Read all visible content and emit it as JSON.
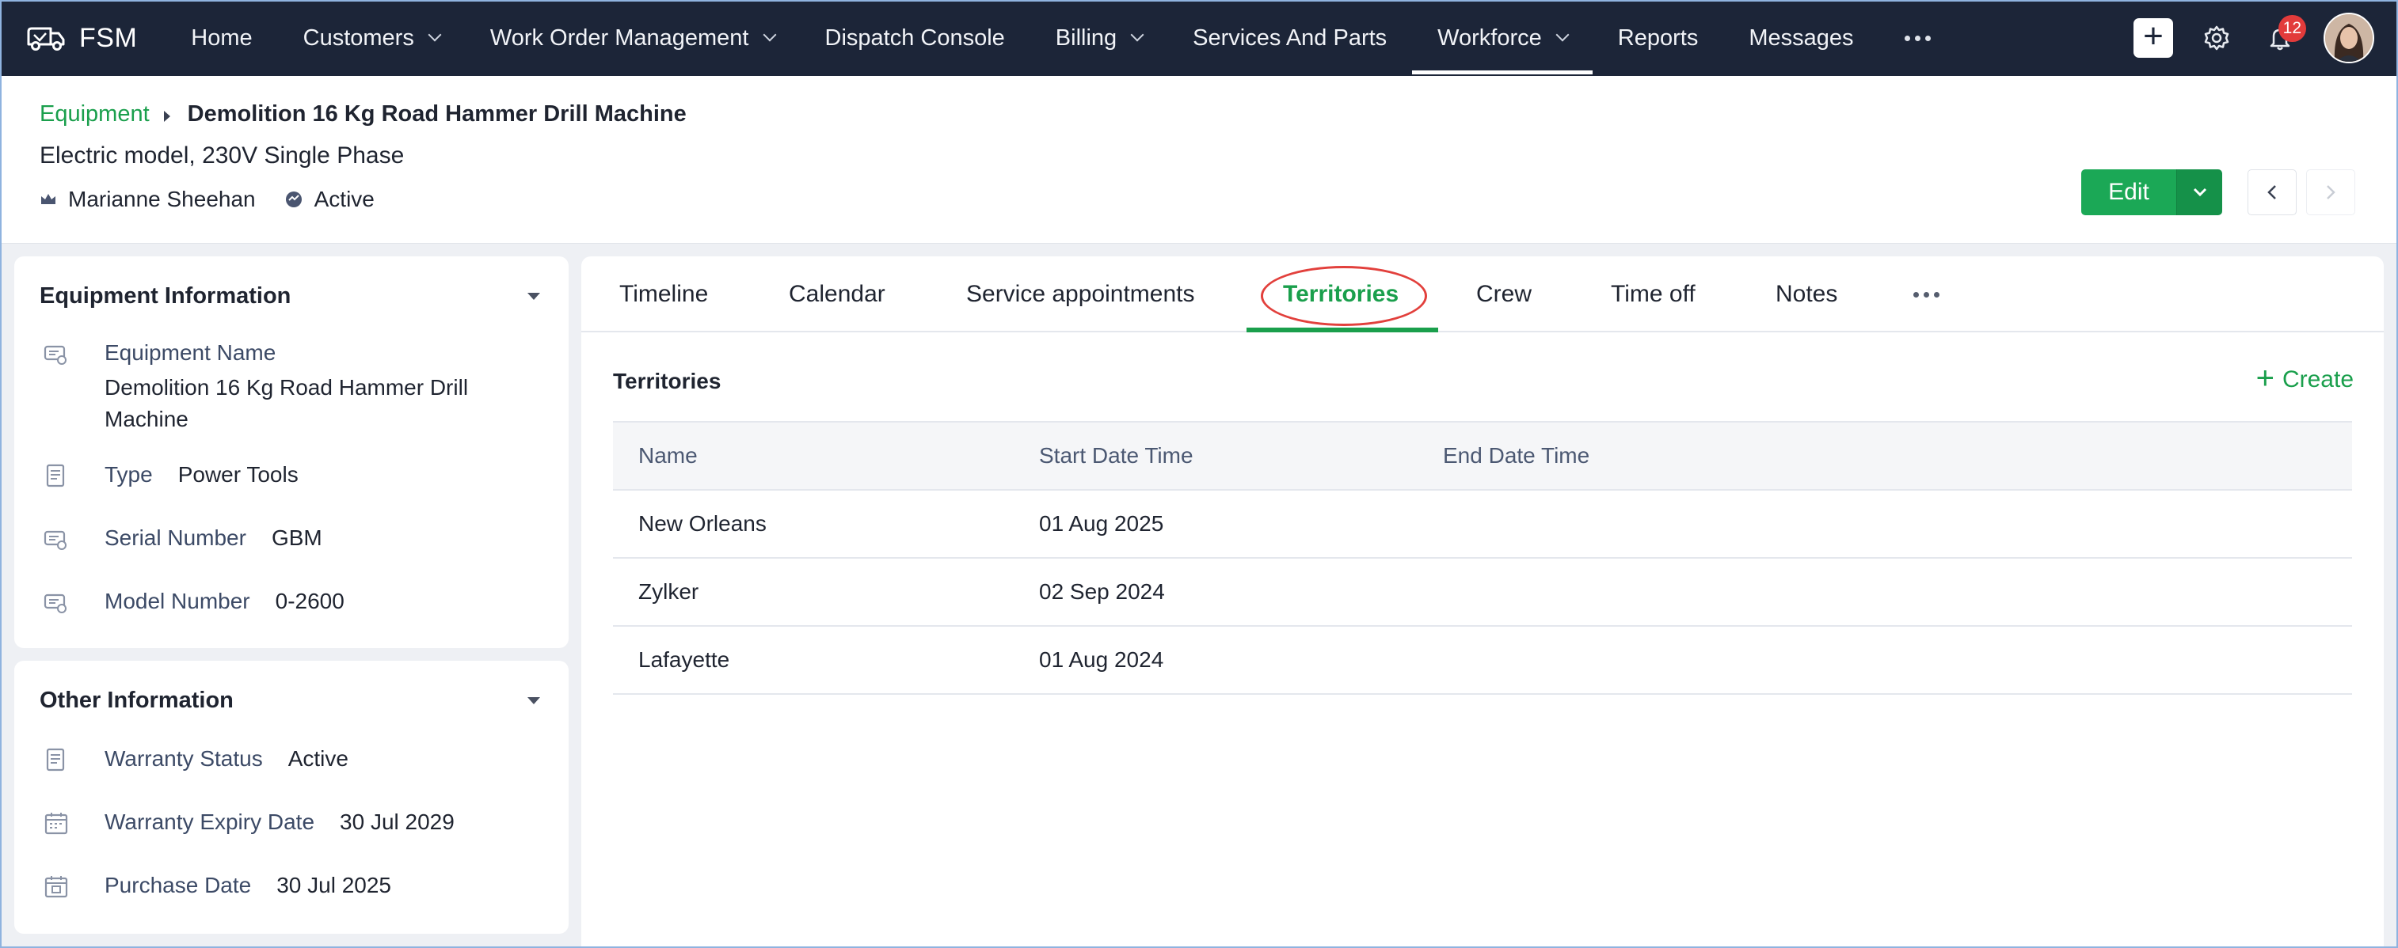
{
  "nav": {
    "brand": "FSM",
    "items": [
      {
        "label": "Home",
        "dropdown": false
      },
      {
        "label": "Customers",
        "dropdown": true
      },
      {
        "label": "Work Order Management",
        "dropdown": true
      },
      {
        "label": "Dispatch Console",
        "dropdown": false
      },
      {
        "label": "Billing",
        "dropdown": true
      },
      {
        "label": "Services And Parts",
        "dropdown": false
      },
      {
        "label": "Workforce",
        "dropdown": true,
        "active": true
      },
      {
        "label": "Reports",
        "dropdown": false
      },
      {
        "label": "Messages",
        "dropdown": false
      }
    ],
    "notification_count": "12"
  },
  "header": {
    "breadcrumb_link": "Equipment",
    "title": "Demolition 16 Kg Road Hammer Drill Machine",
    "subtitle": "Electric model, 230V Single Phase",
    "owner": "Marianne Sheehan",
    "status": "Active",
    "edit_label": "Edit"
  },
  "equipment_info": {
    "title": "Equipment Information",
    "fields": [
      {
        "label": "Equipment Name",
        "value": "Demolition 16 Kg Road Hammer Drill Machine"
      },
      {
        "label": "Type",
        "value": "Power Tools"
      },
      {
        "label": "Serial Number",
        "value": "GBM"
      },
      {
        "label": "Model Number",
        "value": "0-2600"
      }
    ]
  },
  "other_info": {
    "title": "Other Information",
    "fields": [
      {
        "label": "Warranty Status",
        "value": "Active"
      },
      {
        "label": "Warranty Expiry Date",
        "value": "30 Jul 2029"
      },
      {
        "label": "Purchase Date",
        "value": "30 Jul 2025"
      }
    ]
  },
  "tabs": [
    {
      "label": "Timeline"
    },
    {
      "label": "Calendar"
    },
    {
      "label": "Service appointments"
    },
    {
      "label": "Territories",
      "active": true
    },
    {
      "label": "Crew"
    },
    {
      "label": "Time off"
    },
    {
      "label": "Notes"
    }
  ],
  "territories": {
    "title": "Territories",
    "create_label": "Create",
    "columns": [
      "Name",
      "Start Date Time",
      "End Date Time"
    ],
    "rows": [
      {
        "name": "New Orleans",
        "start": "01 Aug 2025",
        "end": ""
      },
      {
        "name": "Zylker",
        "start": "02 Sep 2024",
        "end": ""
      },
      {
        "name": "Lafayette",
        "start": "01 Aug 2024",
        "end": ""
      }
    ]
  },
  "colors": {
    "nav_bg": "#1c2538",
    "accent_green": "#1a9f4c",
    "edit_button": "#1ba856",
    "annotation_red": "#e2403c",
    "badge_red": "#e23b3b"
  }
}
